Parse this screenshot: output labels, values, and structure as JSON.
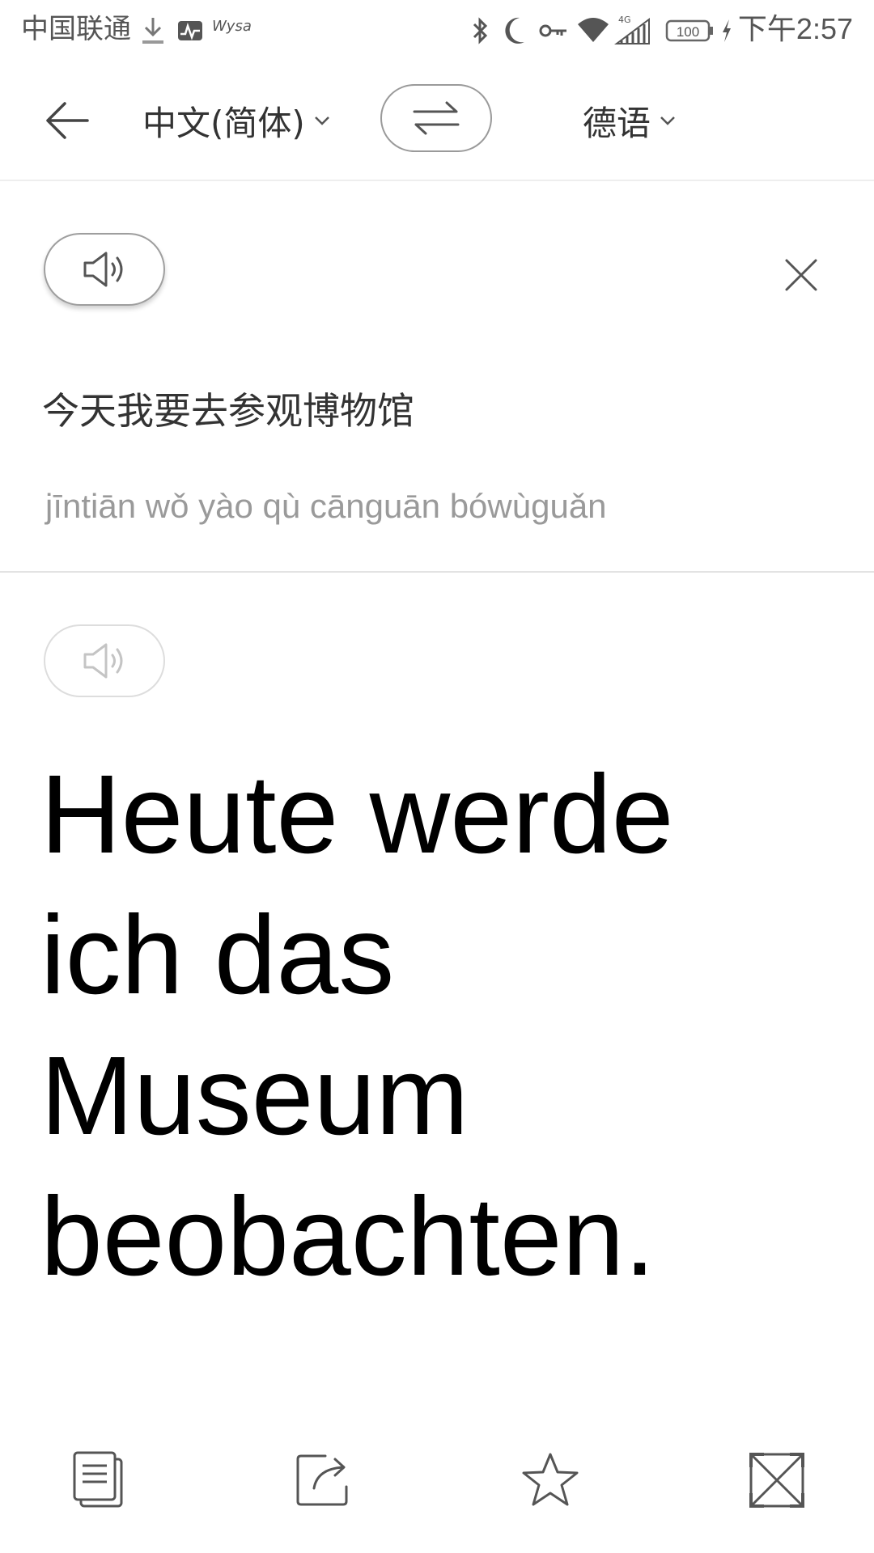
{
  "status_bar": {
    "carrier": "中国联通",
    "app_label": "Wysa",
    "time": "下午2:57",
    "network": "4G",
    "battery": "100"
  },
  "toolbar": {
    "source_language": "中文(简体)",
    "target_language": "德语"
  },
  "source": {
    "text": "今天我要去参观博物馆",
    "pinyin": "jīntiān wǒ yào qù cānguān bówùguǎn"
  },
  "result": {
    "text": "Heute werde ich das Museum beobachten."
  },
  "icons": {
    "back": "arrow-left-icon",
    "swap": "swap-arrows-icon",
    "speaker": "speaker-icon",
    "clear": "close-icon",
    "copy": "copy-icon",
    "share": "share-icon",
    "favorite": "star-icon",
    "fullscreen": "expand-icon"
  }
}
